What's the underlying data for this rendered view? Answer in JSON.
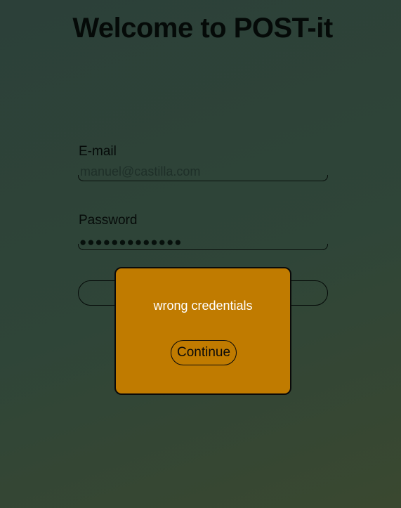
{
  "header": {
    "title": "Welcome to POST-it"
  },
  "form": {
    "email": {
      "label": "E-mail",
      "value": "manuel@castilla.com"
    },
    "password": {
      "label": "Password",
      "masked_value": "●●●●●●●●●●●●●"
    },
    "submit_label": ""
  },
  "dialog": {
    "message": "wrong credentials",
    "continue_label": "Continue",
    "background_color": "#c07b00"
  }
}
